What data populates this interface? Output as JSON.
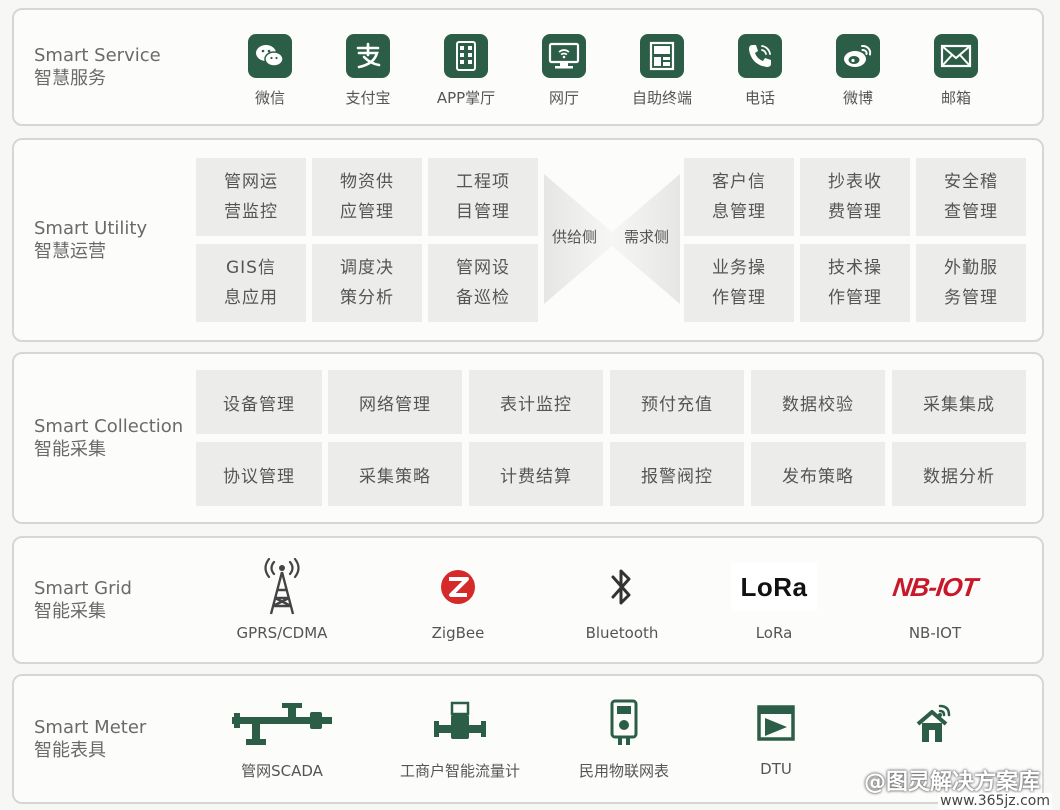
{
  "service": {
    "title_en": "Smart Service",
    "title_zh": "智慧服务",
    "items": [
      {
        "label": "微信",
        "icon": "wechat-icon"
      },
      {
        "label": "支付宝",
        "icon": "alipay-icon"
      },
      {
        "label": "APP掌厅",
        "icon": "mobile-app-icon"
      },
      {
        "label": "网厅",
        "icon": "web-hall-icon"
      },
      {
        "label": "自助终端",
        "icon": "kiosk-icon"
      },
      {
        "label": "电话",
        "icon": "phone-icon"
      },
      {
        "label": "微博",
        "icon": "weibo-icon"
      },
      {
        "label": "邮箱",
        "icon": "mail-icon"
      }
    ]
  },
  "utility": {
    "title_en": "Smart Utility",
    "title_zh": "智慧运营",
    "supply_label": "供给侧",
    "demand_label": "需求侧",
    "supply_cells": [
      [
        "管网运",
        "营监控"
      ],
      [
        "物资供",
        "应管理"
      ],
      [
        "工程项",
        "目管理"
      ],
      [
        "GIS信",
        "息应用"
      ],
      [
        "调度决",
        "策分析"
      ],
      [
        "管网设",
        "备巡检"
      ]
    ],
    "demand_cells": [
      [
        "客户信",
        "息管理"
      ],
      [
        "抄表收",
        "费管理"
      ],
      [
        "安全稽",
        "查管理"
      ],
      [
        "业务操",
        "作管理"
      ],
      [
        "技术操",
        "作管理"
      ],
      [
        "外勤服",
        "务管理"
      ]
    ]
  },
  "collection": {
    "title_en": "Smart Collection",
    "title_zh": "智能采集",
    "row1": [
      "设备管理",
      "网络管理",
      "表计监控",
      "预付充值",
      "数据校验",
      "采集集成"
    ],
    "row2": [
      "协议管理",
      "采集策略",
      "计费结算",
      "报警阀控",
      "发布策略",
      "数据分析"
    ]
  },
  "grid": {
    "title_en": "Smart Grid",
    "title_zh": "智能采集",
    "items": [
      {
        "label": "GPRS/CDMA",
        "icon": "cell-tower-icon"
      },
      {
        "label": "ZigBee",
        "icon": "zigbee-icon"
      },
      {
        "label": "Bluetooth",
        "icon": "bluetooth-icon"
      },
      {
        "label": "LoRa",
        "icon": "lora-logo",
        "logo_text": "LoRa"
      },
      {
        "label": "NB-IOT",
        "icon": "nb-iot-logo",
        "logo_text": "NB-IOT"
      }
    ]
  },
  "meter": {
    "title_en": "Smart Meter",
    "title_zh": "智能表具",
    "items": [
      {
        "label": "管网SCADA",
        "icon": "pipeline-scada-icon"
      },
      {
        "label": "工商户智能流量计",
        "icon": "flow-meter-icon"
      },
      {
        "label": "民用物联网表",
        "icon": "iot-meter-icon"
      },
      {
        "label": "DTU",
        "icon": "dtu-icon"
      },
      {
        "label": "",
        "icon": "smart-home-icon"
      }
    ]
  },
  "watermark": {
    "text": "@图灵解决方案库",
    "url": "www.365jz.com"
  },
  "colors": {
    "icon_green": "#2c5e47",
    "zigbee_red": "#d62a2a",
    "nbiot_red": "#c8192a"
  }
}
